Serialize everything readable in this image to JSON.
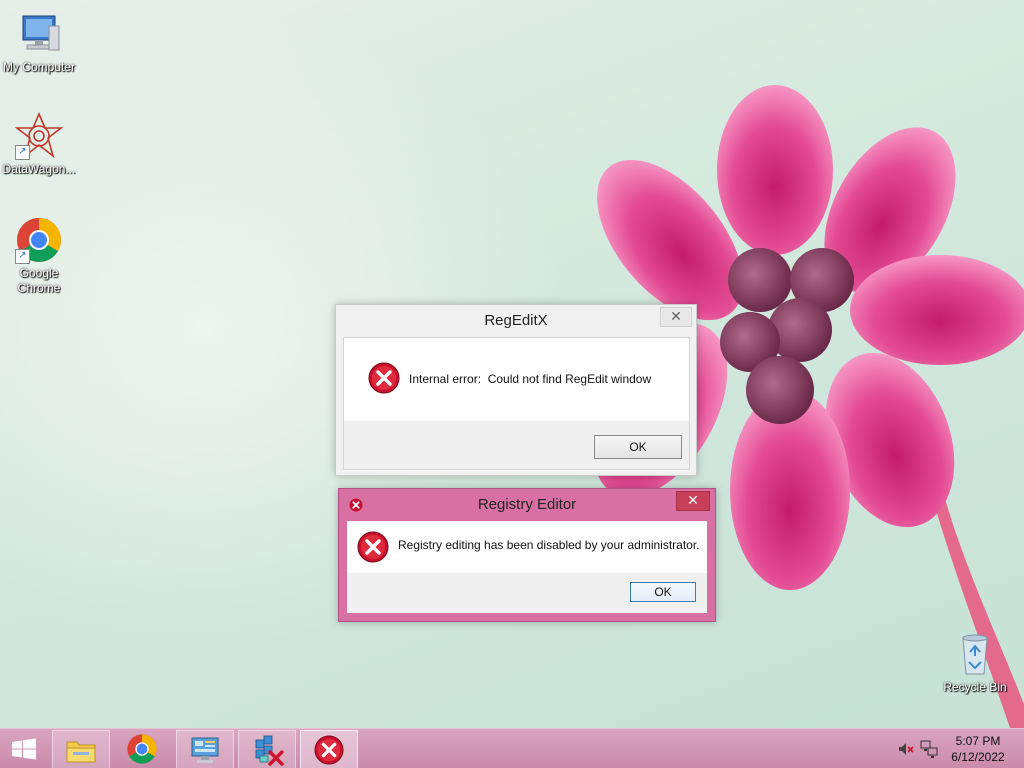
{
  "desktop": {
    "icons": [
      {
        "label": "My Computer",
        "icon": "computer-icon"
      },
      {
        "label": "DataWagon...",
        "icon": "datawagon-icon"
      },
      {
        "label": "Google Chrome",
        "icon": "chrome-icon"
      },
      {
        "label": "Recycle Bin",
        "icon": "recycle-bin-icon"
      }
    ]
  },
  "dialog_regeditx": {
    "title": "RegEditX",
    "close_label": "✕",
    "message": "Internal error:  Could not find RegEdit window",
    "ok_label": "OK",
    "icon": "error-icon"
  },
  "dialog_registry_editor": {
    "title": "Registry Editor",
    "close_label": "✕",
    "message": "Registry editing has been disabled by your administrator.",
    "ok_label": "OK",
    "icon": "error-icon",
    "accent_color": "#d970a4"
  },
  "taskbar": {
    "items": [
      {
        "name": "file-explorer",
        "icon": "folder-icon"
      },
      {
        "name": "chrome",
        "icon": "chrome-icon"
      },
      {
        "name": "control-panel",
        "icon": "control-panel-icon"
      },
      {
        "name": "regeditx",
        "icon": "registry-disabled-icon"
      },
      {
        "name": "error-dialog",
        "icon": "error-icon"
      }
    ],
    "tray_icons": [
      "speaker-muted-icon",
      "network-icon"
    ],
    "time": "5:07 PM",
    "date": "6/12/2022"
  }
}
